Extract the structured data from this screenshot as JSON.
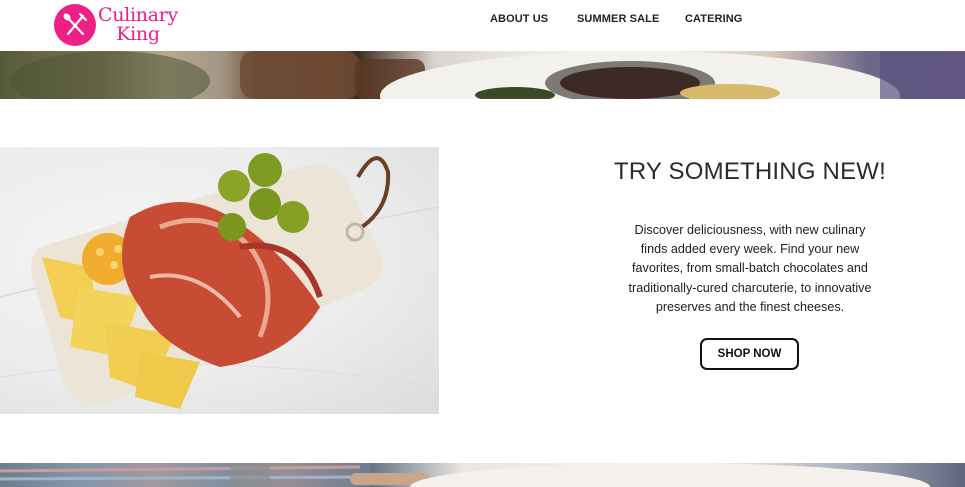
{
  "brand": {
    "name_line1": "Culinary",
    "name_line2": "King",
    "color": "#ee1f85",
    "icon": "fork-knife-icon"
  },
  "nav": {
    "items": [
      {
        "label": "ABOUT US"
      },
      {
        "label": "SUMMER SALE"
      },
      {
        "label": "CATERING"
      }
    ]
  },
  "promo": {
    "title": "TRY SOMETHING NEW!",
    "body": "Discover deliciousness, with new culinary finds added every week. Find your new favorites, from small-batch chocolates and traditionally-cured charcuterie, to innovative preserves and the finest cheeses.",
    "cta_label": "SHOP NOW"
  }
}
